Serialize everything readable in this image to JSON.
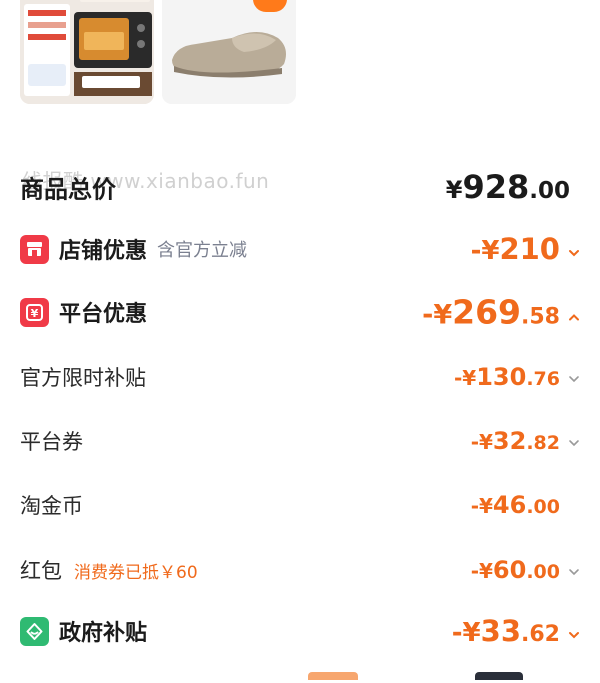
{
  "watermark": "线报酷 www.xianbao.fun",
  "total": {
    "label": "商品总价",
    "currency": "¥",
    "int": "928",
    "dec": ".00"
  },
  "shop": {
    "label": "店铺优惠",
    "hint": "含官方立减",
    "prefix": "-¥",
    "int": "210",
    "dec": ""
  },
  "platform": {
    "label": "平台优惠",
    "prefix": "-¥",
    "int": "269",
    "dec": ".58"
  },
  "subsidy": {
    "label": "官方限时补贴",
    "prefix": "-¥",
    "int": "130",
    "dec": ".76"
  },
  "coupon": {
    "label": "平台券",
    "prefix": "-¥",
    "int": "32",
    "dec": ".82"
  },
  "coin": {
    "label": "淘金币",
    "prefix": "-¥",
    "int": "46",
    "dec": ".00"
  },
  "redpack": {
    "label": "红包",
    "hint": "消费券已抵￥60",
    "prefix": "-¥",
    "int": "60",
    "dec": ".00"
  },
  "gov": {
    "label": "政府补贴",
    "prefix": "-¥",
    "int": "33",
    "dec": ".62"
  },
  "colors": {
    "accent": "#f06a1c",
    "red_icon": "#f03a47",
    "green_icon": "#2fba72"
  }
}
